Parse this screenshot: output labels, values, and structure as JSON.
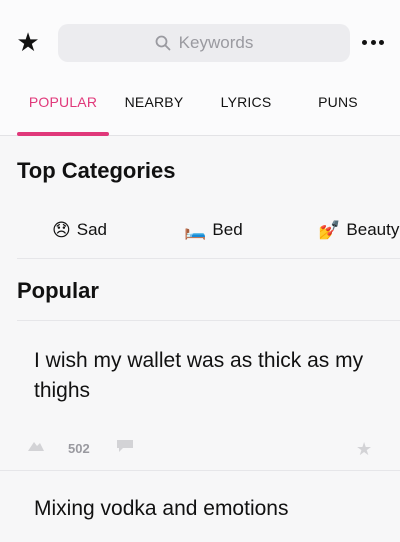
{
  "search": {
    "placeholder": "Keywords"
  },
  "tabs": [
    {
      "label": "POPULAR",
      "active": true
    },
    {
      "label": "NEARBY",
      "active": false
    },
    {
      "label": "LYRICS",
      "active": false
    },
    {
      "label": "PUNS",
      "active": false
    }
  ],
  "top_categories": {
    "title": "Top Categories",
    "items": [
      {
        "emoji": "😞",
        "label": "Sad"
      },
      {
        "emoji": "🛏️",
        "label": "Bed"
      },
      {
        "emoji": "💅",
        "label": "Beauty"
      }
    ]
  },
  "popular": {
    "title": "Popular",
    "posts": [
      {
        "text": "I wish my wallet was as thick as my thighs",
        "likes": "502"
      },
      {
        "text": "Mixing vodka and emotions"
      }
    ]
  },
  "colors": {
    "accent": "#e0387a",
    "background": "#f7f7f8"
  },
  "icons": [
    "star-icon",
    "search-icon",
    "more-icon",
    "like-icon",
    "comment-icon",
    "bookmark-icon"
  ]
}
